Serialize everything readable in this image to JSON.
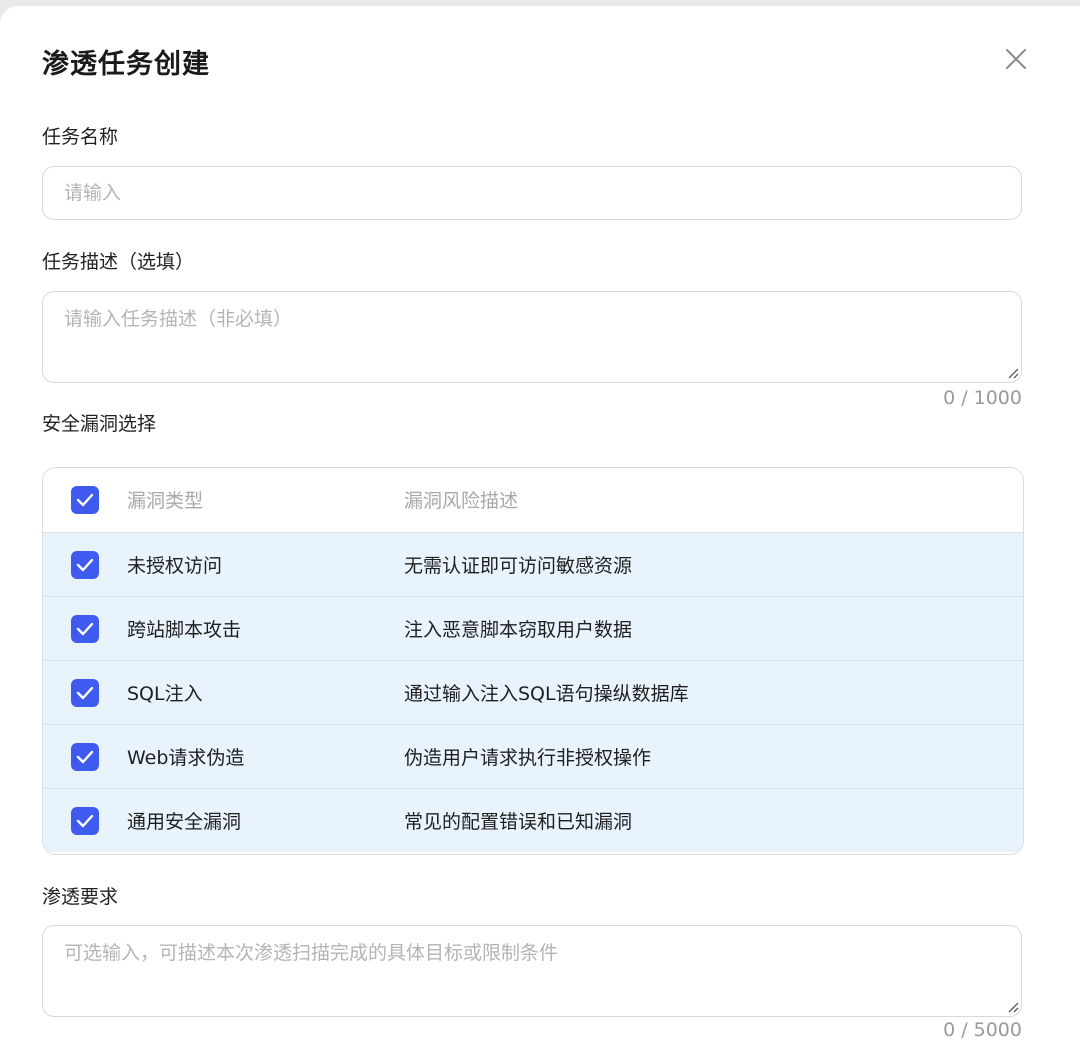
{
  "dialog": {
    "title": "渗透任务创建"
  },
  "task_name": {
    "label": "任务名称",
    "placeholder": "请输入",
    "value": ""
  },
  "task_description": {
    "label": "任务描述（选填）",
    "placeholder": "请输入任务描述（非必填）",
    "value": "",
    "counter": "0 / 1000"
  },
  "vulnerabilities": {
    "label": "安全漏洞选择",
    "header": {
      "type": "漏洞类型",
      "desc": "漏洞风险描述",
      "checked": true
    },
    "rows": [
      {
        "type": "未授权访问",
        "desc": "无需认证即可访问敏感资源",
        "checked": true
      },
      {
        "type": "跨站脚本攻击",
        "desc": "注入恶意脚本窃取用户数据",
        "checked": true
      },
      {
        "type": "SQL注入",
        "desc": "通过输入注入SQL语句操纵数据库",
        "checked": true
      },
      {
        "type": "Web请求伪造",
        "desc": "伪造用户请求执行非授权操作",
        "checked": true
      },
      {
        "type": "通用安全漏洞",
        "desc": "常见的配置错误和已知漏洞",
        "checked": true
      }
    ]
  },
  "requirements": {
    "label": "渗透要求",
    "placeholder": "可选输入，可描述本次渗透扫描完成的具体目标或限制条件",
    "value": "",
    "counter": "0 / 5000"
  },
  "icons": {
    "close": "close-icon",
    "check": "checkmark-icon",
    "resize": "resize-grip-icon"
  },
  "colors": {
    "checkbox": "#3f5bef",
    "row_bg": "#e8f3fd"
  }
}
